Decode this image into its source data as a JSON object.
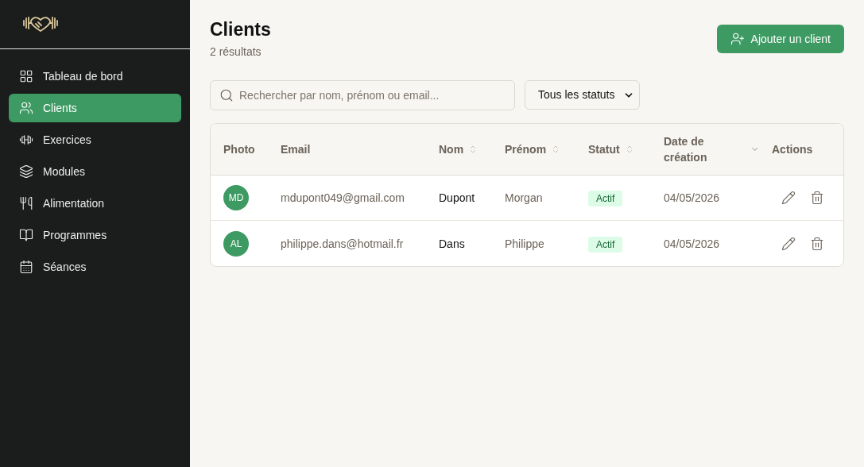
{
  "sidebar": {
    "items": [
      {
        "label": "Tableau de bord",
        "selected": false
      },
      {
        "label": "Clients",
        "selected": true
      },
      {
        "label": "Exercices",
        "selected": false
      },
      {
        "label": "Modules",
        "selected": false
      },
      {
        "label": "Alimentation",
        "selected": false
      },
      {
        "label": "Programmes",
        "selected": false
      },
      {
        "label": "Séances",
        "selected": false
      }
    ]
  },
  "header": {
    "title": "Clients",
    "count": "2 résultats",
    "add_button": "Ajouter un client"
  },
  "filters": {
    "search_placeholder": "Rechercher par nom, prénom ou email...",
    "status_select": "Tous les statuts"
  },
  "table": {
    "columns": [
      {
        "label": "Photo",
        "kind": "plain"
      },
      {
        "label": "Email",
        "kind": "plain"
      },
      {
        "label": "Nom",
        "kind": "sortable"
      },
      {
        "label": "Prénom",
        "kind": "sortable"
      },
      {
        "label": "Statut",
        "kind": "sortable"
      },
      {
        "label": "Date de création",
        "kind": "sorted"
      },
      {
        "label": "Actions",
        "kind": "plain"
      }
    ],
    "rows": [
      {
        "initials": "MD",
        "email": "mdupont049@gmail.com",
        "nom": "Dupont",
        "prenom": "Morgan",
        "status": "Actif",
        "date": "04/05/2026"
      },
      {
        "initials": "AL",
        "email": "philippe.dans@hotmail.fr",
        "nom": "Dans",
        "prenom": "Philippe",
        "status": "Actif",
        "date": "04/05/2026"
      }
    ]
  }
}
